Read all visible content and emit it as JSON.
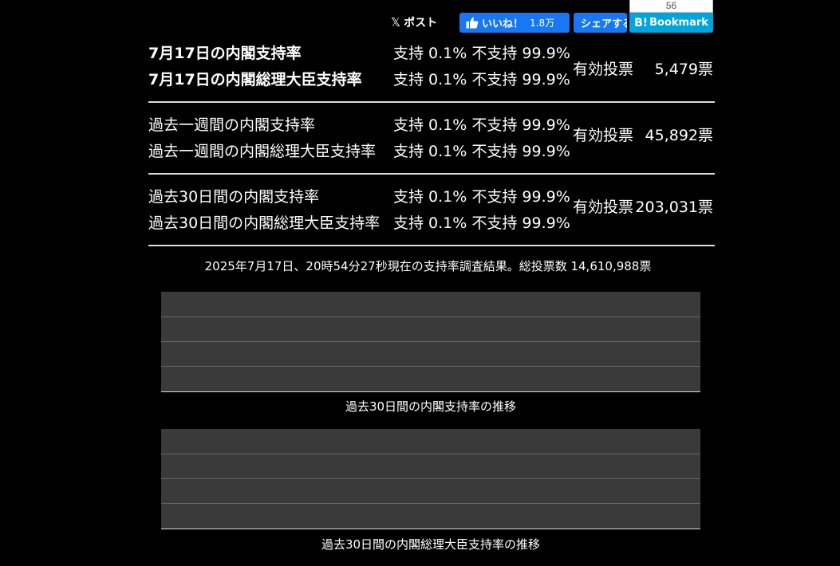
{
  "share": {
    "x_logo": "𝕏",
    "x_label": "ポスト",
    "fb_like_label": "いいね！",
    "fb_like_count": "1.8万",
    "fb_share_label": "シェアする",
    "hatena_count": "56",
    "hatena_mark": "B!",
    "hatena_label": "Bookmark",
    "colors": {
      "facebook": "#1877f2",
      "hatena": "#00a4de"
    }
  },
  "results": {
    "today": {
      "cabinet_label": "7月17日の内閣支持率",
      "cabinet_rate": "支持 0.1% 不支持 99.9%",
      "pm_label": "7月17日の内閣総理大臣支持率",
      "pm_rate": "支持 0.1% 不支持 99.9%",
      "votes_label": "有効投票",
      "votes_value": "5,479票"
    },
    "week": {
      "cabinet_label": "過去一週間の内閣支持率",
      "cabinet_rate": "支持 0.1% 不支持 99.9%",
      "pm_label": "過去一週間の内閣総理大臣支持率",
      "pm_rate": "支持 0.1% 不支持 99.9%",
      "votes_label": "有効投票",
      "votes_value": "45,892票"
    },
    "month": {
      "cabinet_label": "過去30日間の内閣支持率",
      "cabinet_rate": "支持 0.1% 不支持 99.9%",
      "pm_label": "過去30日間の内閣総理大臣支持率",
      "pm_rate": "支持 0.1% 不支持 99.9%",
      "votes_label": "有効投票",
      "votes_value": "203,031票"
    }
  },
  "summary": "2025年7月17日、20時54分27秒現在の支持率調査結果。総投票数 14,610,988票",
  "charts": {
    "cabinet_caption": "過去30日間の内閣支持率の推移",
    "pm_caption": "過去30日間の内閣総理大臣支持率の推移"
  }
}
